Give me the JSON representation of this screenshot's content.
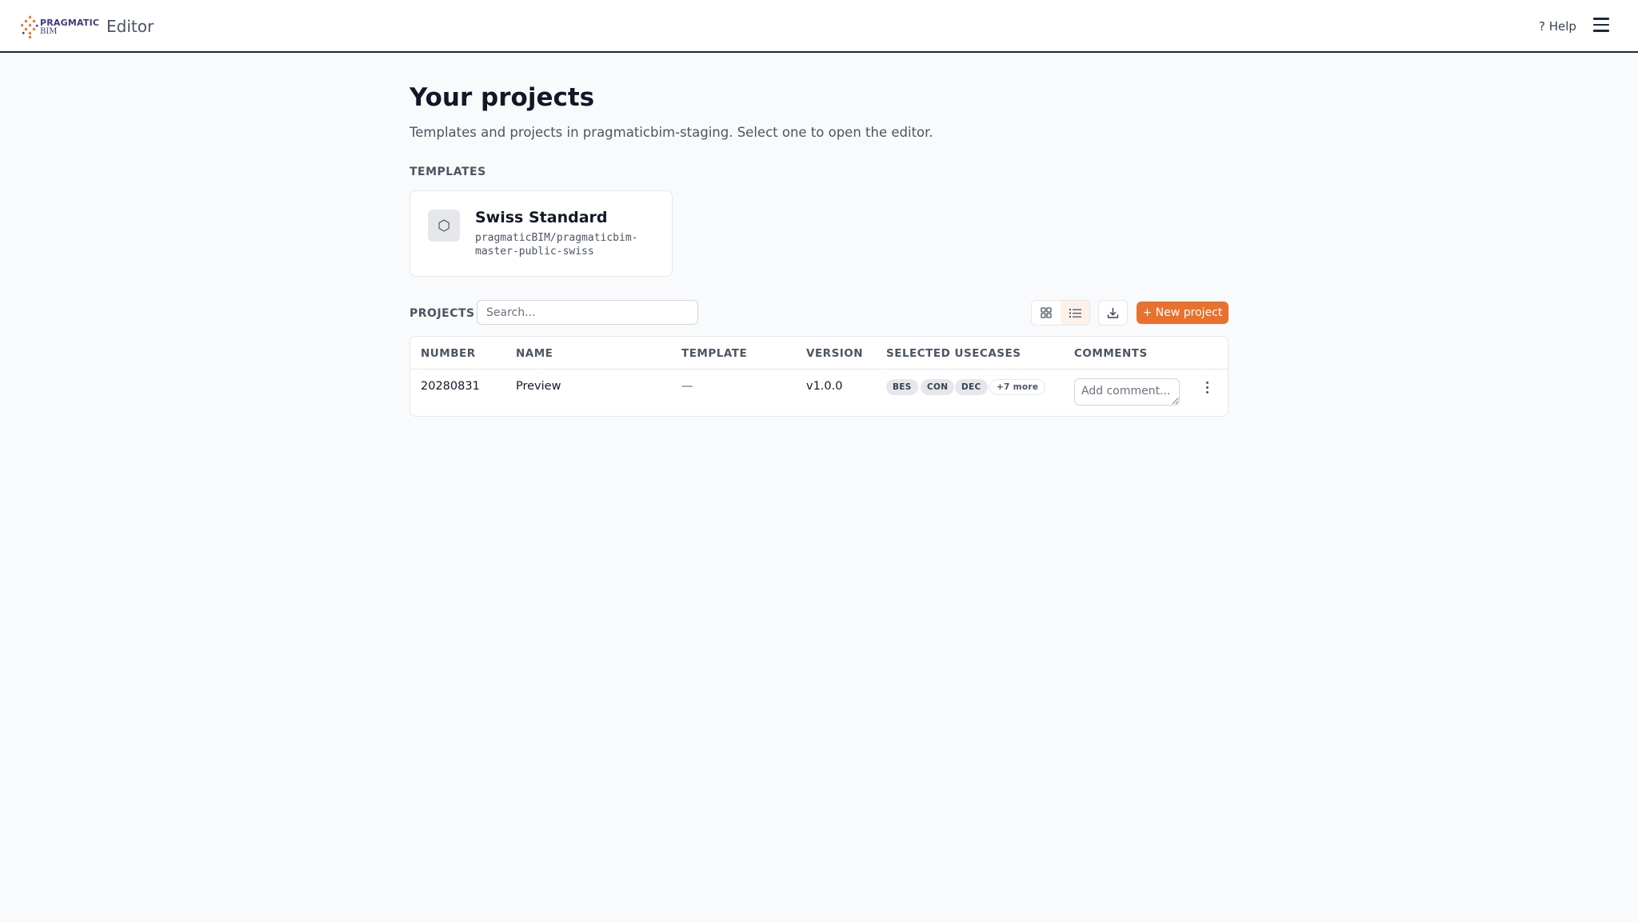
{
  "header": {
    "logo_line1": "PRAGMATIC",
    "logo_line2": "BIM",
    "app_title": "Editor",
    "help_label": "? Help",
    "menu_icon": "hamburger-menu-icon"
  },
  "main": {
    "title": "Your projects",
    "subtitle": "Templates and projects in pragmaticbim-staging. Select one to open the editor.",
    "templates_label": "TEMPLATES",
    "templates": [
      {
        "icon": "hexagon-icon",
        "icon_glyph": "⬡",
        "name": "Swiss Standard",
        "repo": "pragmaticBIM/pragmaticbim-master-public-swiss"
      }
    ],
    "projects_label": "PROJECTS",
    "search_placeholder": "Search...",
    "new_project_label": "+ New project",
    "view_mode": "list"
  },
  "table": {
    "columns": [
      "NUMBER",
      "NAME",
      "TEMPLATE",
      "VERSION",
      "SELECTED USECASES",
      "COMMENTS"
    ],
    "rows": [
      {
        "number": "20280831",
        "name": "Preview",
        "template": "—",
        "version": "v1.0.0",
        "usecases": [
          "BES",
          "CON",
          "DEC"
        ],
        "more": "+7 more",
        "comment_placeholder": "Add comment..."
      }
    ]
  },
  "colors": {
    "accent": "#e8712d",
    "header_border": "#1f2937",
    "background": "#f9fafb"
  }
}
